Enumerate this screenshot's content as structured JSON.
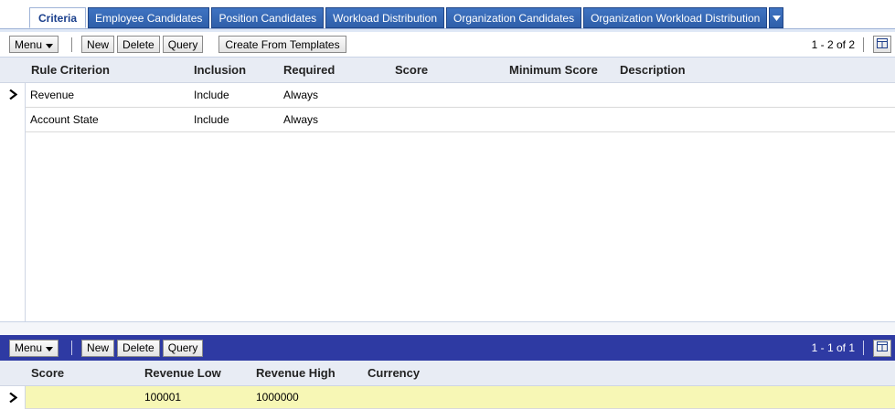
{
  "tabs": [
    {
      "label": "Criteria",
      "active": true
    },
    {
      "label": "Employee Candidates",
      "active": false
    },
    {
      "label": "Position Candidates",
      "active": false
    },
    {
      "label": "Workload Distribution",
      "active": false
    },
    {
      "label": "Organization Candidates",
      "active": false
    },
    {
      "label": "Organization Workload Distribution",
      "active": false
    }
  ],
  "criteria_applet": {
    "toolbar": {
      "menu_label": "Menu",
      "new_label": "New",
      "delete_label": "Delete",
      "query_label": "Query",
      "templates_label": "Create From Templates",
      "pager": "1 - 2 of 2"
    },
    "columns": [
      "Rule Criterion",
      "Inclusion",
      "Required",
      "Score",
      "Minimum Score",
      "Description"
    ],
    "rows": [
      {
        "rule_criterion": "Revenue",
        "inclusion": "Include",
        "required": "Always",
        "score": "",
        "minimum_score": "",
        "description": "",
        "current": true
      },
      {
        "rule_criterion": "Account State",
        "inclusion": "Include",
        "required": "Always",
        "score": "",
        "minimum_score": "",
        "description": "",
        "current": false
      }
    ]
  },
  "values_applet": {
    "toolbar": {
      "menu_label": "Menu",
      "new_label": "New",
      "delete_label": "Delete",
      "query_label": "Query",
      "pager": "1 - 1 of 1"
    },
    "columns": [
      "Score",
      "Revenue Low",
      "Revenue High",
      "Currency"
    ],
    "rows": [
      {
        "score": "",
        "revenue_low": "100001",
        "revenue_high": "1000000",
        "currency": "",
        "current": true
      }
    ]
  },
  "colors": {
    "tab_blue": "#2f5fa9",
    "bottom_toolbar": "#2e3aa3",
    "selected_row": "#f7f7b5",
    "header_bg": "#e8ecf4"
  },
  "icons": {
    "tab_overflow": "chevron-down-icon",
    "column_picker": "columns-icon",
    "row_indicator": "chevron-right-icon"
  }
}
